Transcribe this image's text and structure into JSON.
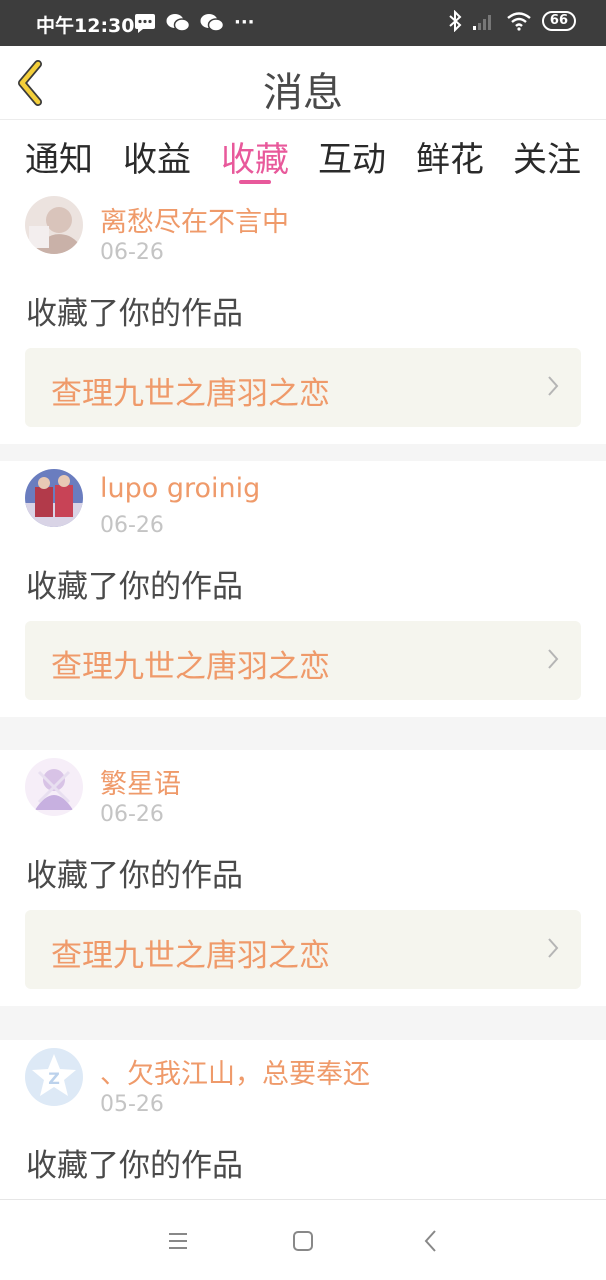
{
  "status_bar": {
    "time": "中午12:30",
    "more": "···",
    "battery": "66",
    "left_icons": [
      "message-icon",
      "wechat-icon",
      "wechat-icon"
    ],
    "right_icons": [
      "bluetooth-icon",
      "signal-icon",
      "wifi-icon",
      "battery-icon"
    ]
  },
  "header": {
    "title": "消息",
    "back_icon": "chevron-left-icon"
  },
  "tabs": [
    {
      "label": "通知",
      "active": false
    },
    {
      "label": "收益",
      "active": false
    },
    {
      "label": "收藏",
      "active": true
    },
    {
      "label": "互动",
      "active": false
    },
    {
      "label": "鲜花",
      "active": false
    },
    {
      "label": "关注",
      "active": false
    }
  ],
  "colors": {
    "accent": "#e8599b",
    "name": "#ef9a6a",
    "date": "#c4c4c4",
    "work_bg": "#f5f5ee"
  },
  "items": [
    {
      "user": "离愁尽在不言中",
      "date": "06-26",
      "action": "收藏了你的作品",
      "work": "查理九世之唐羽之恋"
    },
    {
      "user": "lupo groinig",
      "date": "06-26",
      "action": "收藏了你的作品",
      "work": "查理九世之唐羽之恋"
    },
    {
      "user": "繁星语",
      "date": "06-26",
      "action": "收藏了你的作品",
      "work": "查理九世之唐羽之恋"
    },
    {
      "user": "、欠我江山，总要奉还",
      "date": "05-26",
      "action": "收藏了你的作品",
      "work": ""
    }
  ],
  "bottom_nav": [
    "menu-icon",
    "home-icon",
    "back-icon"
  ]
}
